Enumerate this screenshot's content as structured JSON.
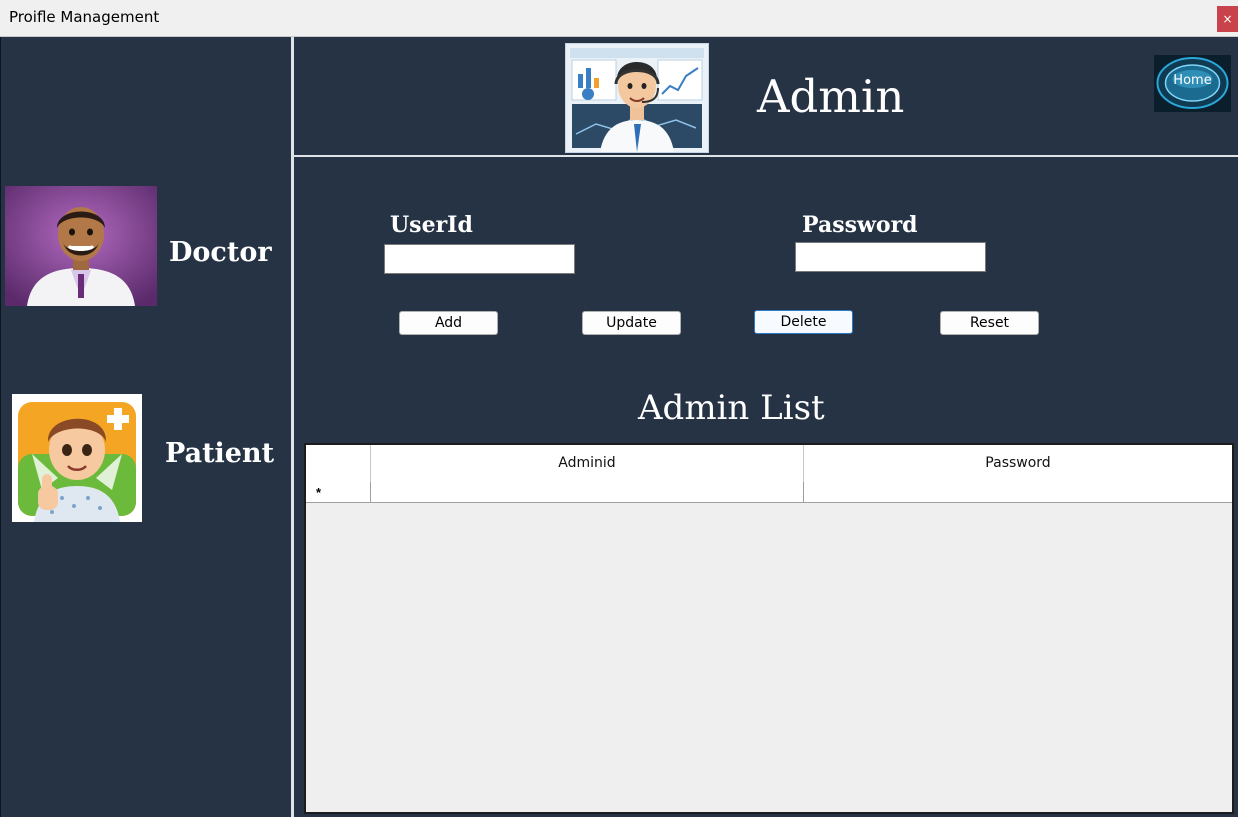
{
  "window": {
    "title": "Proifle Management",
    "close_glyph": "×"
  },
  "sidebar": {
    "items": [
      {
        "label": "Doctor",
        "icon": "doctor-avatar"
      },
      {
        "label": "Patient",
        "icon": "patient-avatar"
      }
    ]
  },
  "header": {
    "title": "Admin",
    "home_label": "Home",
    "banner_icon": "admin-support-banner"
  },
  "form": {
    "userid_label": "UserId",
    "userid_value": "",
    "password_label": "Password",
    "password_value": ""
  },
  "buttons": {
    "add": "Add",
    "update": "Update",
    "delete": "Delete",
    "reset": "Reset"
  },
  "list": {
    "title": "Admin List",
    "columns": [
      "Adminid",
      "Password"
    ],
    "new_row_marker": "*",
    "rows": []
  },
  "colors": {
    "background": "#263344",
    "close": "#c8434b",
    "divider": "#dfe3e8"
  }
}
